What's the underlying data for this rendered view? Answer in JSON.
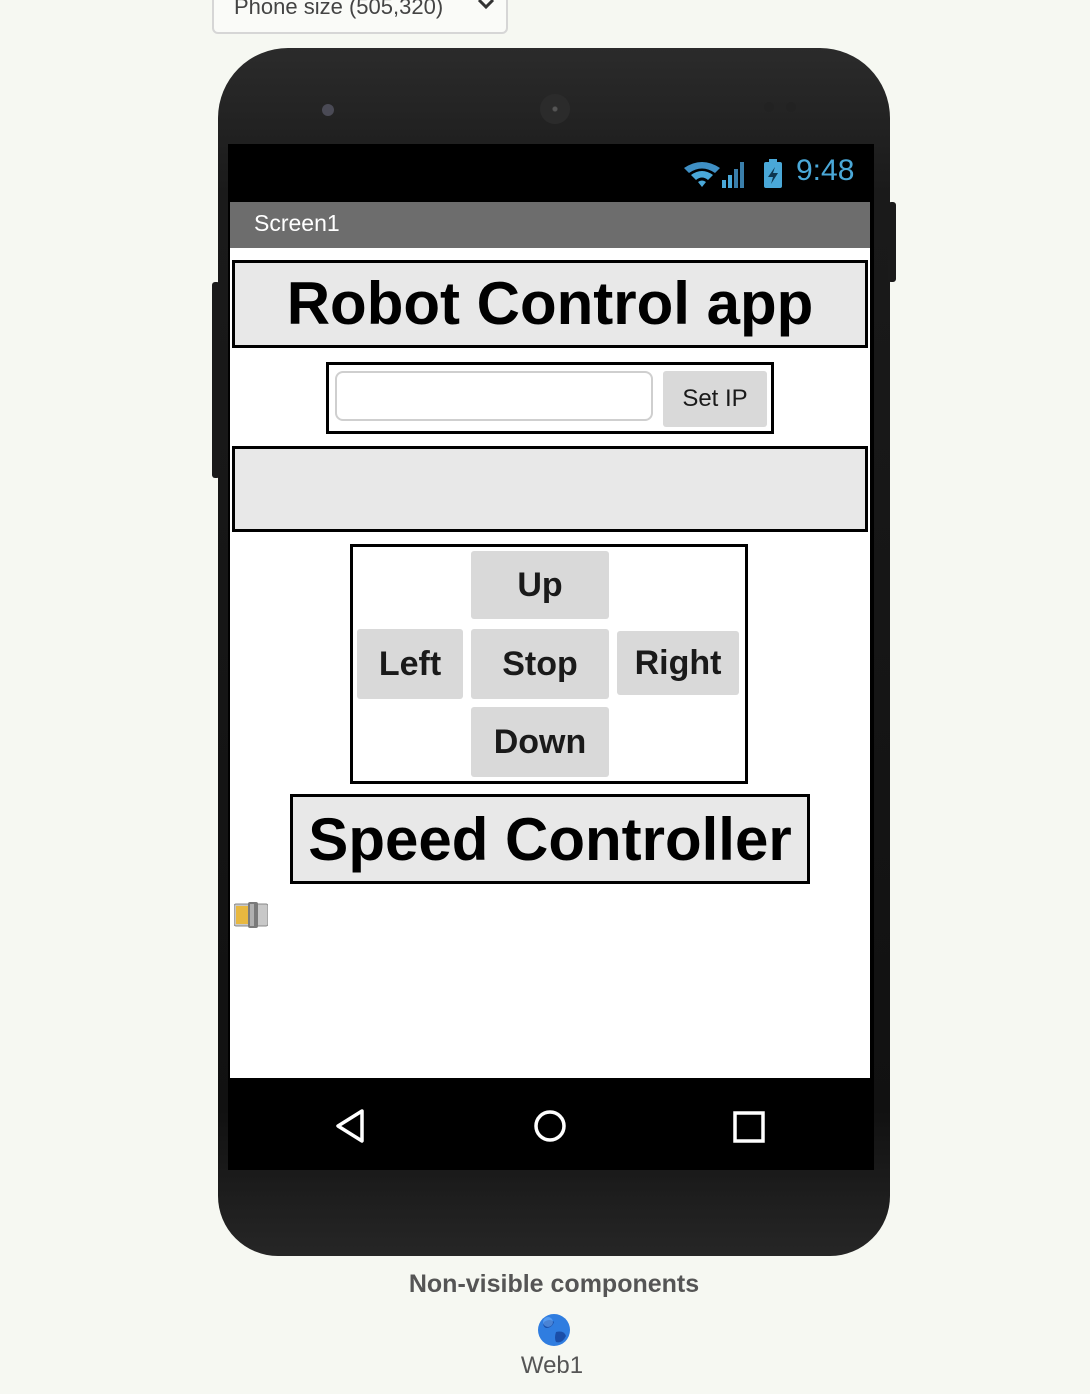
{
  "designer": {
    "phone_size_selector": "Phone size (505,320)"
  },
  "device": {
    "status_bar": {
      "time": "9:48",
      "icons": [
        "wifi-icon",
        "signal-icon",
        "battery-icon"
      ]
    },
    "screen_title": "Screen1",
    "app": {
      "title_label": "Robot Control app",
      "ip_textbox": {
        "value": "",
        "placeholder": ""
      },
      "set_ip_button": "Set IP",
      "status_label": "",
      "controls": {
        "up": "Up",
        "left": "Left",
        "stop": "Stop",
        "right": "Right",
        "down": "Down"
      },
      "speed_label": "Speed Controller",
      "speed_slider_icon": "slider-icon"
    },
    "nav_bar": {
      "icons": [
        "back-icon",
        "home-icon",
        "recent-apps-icon"
      ]
    }
  },
  "non_visible": {
    "title": "Non-visible components",
    "components": [
      {
        "name": "Web1",
        "icon": "globe-icon"
      }
    ]
  },
  "colors": {
    "background": "#f6f8f2",
    "title_bar": "#6d6d6d",
    "button": "#d9d9d9",
    "label_bg": "#e8e8e8",
    "clock": "#4aa8d8"
  }
}
